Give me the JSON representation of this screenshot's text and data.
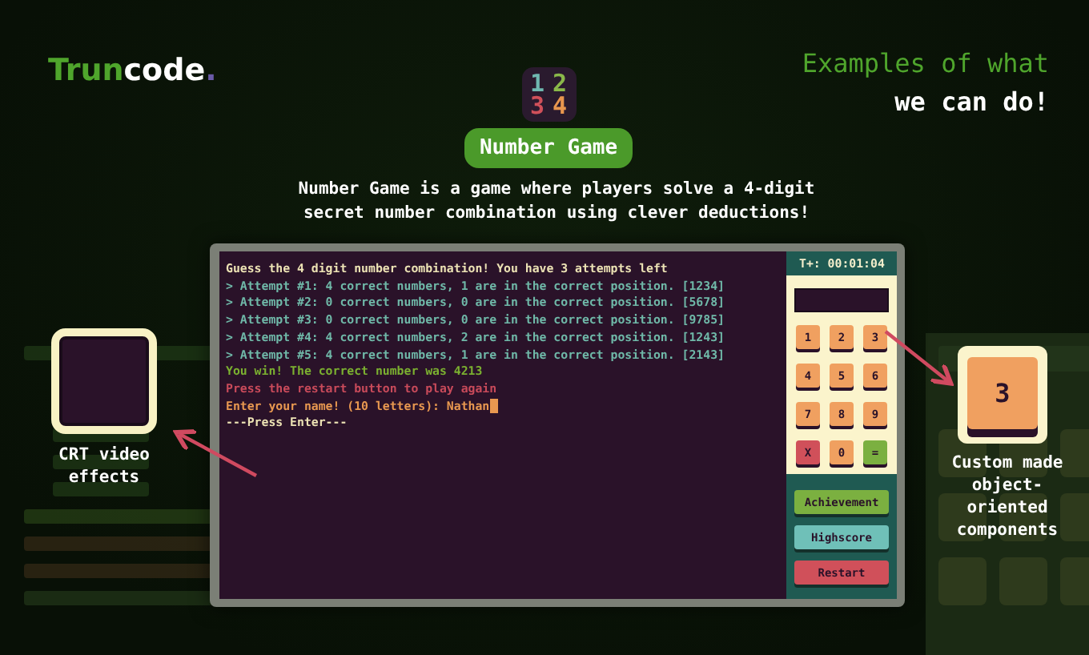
{
  "brand": {
    "name_a": "Trun",
    "name_b": "code",
    "dot": "."
  },
  "tagline": {
    "line_1": "Examples of what",
    "line_2": "we can do!"
  },
  "project": {
    "icon_digits": [
      {
        "text": "1",
        "color": "#6fb8b0"
      },
      {
        "text": "2",
        "color": "#8ab84a"
      },
      {
        "text": "3",
        "color": "#d0505a"
      },
      {
        "text": "4",
        "color": "#e8964e"
      }
    ],
    "title": "Number Game",
    "description": "Number Game is a game where players solve a 4-digit secret number combination using clever deductions!"
  },
  "terminal": {
    "lines": [
      {
        "kind": "prompt",
        "text": "Guess the 4 digit number combination! You have 3 attempts left"
      },
      {
        "kind": "attempt",
        "text": "> Attempt #1: 4 correct numbers, 1 are in the correct position. [1234]"
      },
      {
        "kind": "attempt",
        "text": "> Attempt #2: 0 correct numbers, 0 are in the correct position. [5678]"
      },
      {
        "kind": "attempt",
        "text": "> Attempt #3: 0 correct numbers, 0 are in the correct position. [9785]"
      },
      {
        "kind": "attempt",
        "text": "> Attempt #4: 4 correct numbers, 2 are in the correct position. [1243]"
      },
      {
        "kind": "attempt",
        "text": "> Attempt #5: 4 correct numbers, 1 are in the correct position. [2143]"
      },
      {
        "kind": "win",
        "text": "You win! The correct number was 4213"
      },
      {
        "kind": "notice",
        "text": "Press the restart button to play again"
      },
      {
        "kind": "input",
        "text": "Enter your name! (10 letters): Nathan"
      },
      {
        "kind": "prompt",
        "text": "---Press Enter---"
      }
    ],
    "timer": "T+: 00:01:04",
    "keys": [
      {
        "label": "1",
        "kind": "digit"
      },
      {
        "label": "2",
        "kind": "digit"
      },
      {
        "label": "3",
        "kind": "digit"
      },
      {
        "label": "4",
        "kind": "digit"
      },
      {
        "label": "5",
        "kind": "digit"
      },
      {
        "label": "6",
        "kind": "digit"
      },
      {
        "label": "7",
        "kind": "digit"
      },
      {
        "label": "8",
        "kind": "digit"
      },
      {
        "label": "9",
        "kind": "digit"
      },
      {
        "label": "X",
        "kind": "clear"
      },
      {
        "label": "0",
        "kind": "digit"
      },
      {
        "label": "=",
        "kind": "enter"
      }
    ],
    "buttons": [
      {
        "label": "Achievement",
        "kind": "achievement"
      },
      {
        "label": "Highscore",
        "kind": "highscore"
      },
      {
        "label": "Restart",
        "kind": "restart"
      }
    ]
  },
  "callouts": [
    {
      "kind": "crt",
      "label": "CRT video effects"
    },
    {
      "kind": "component",
      "label": "Custom made object-oriented components",
      "key_label": "3"
    }
  ]
}
